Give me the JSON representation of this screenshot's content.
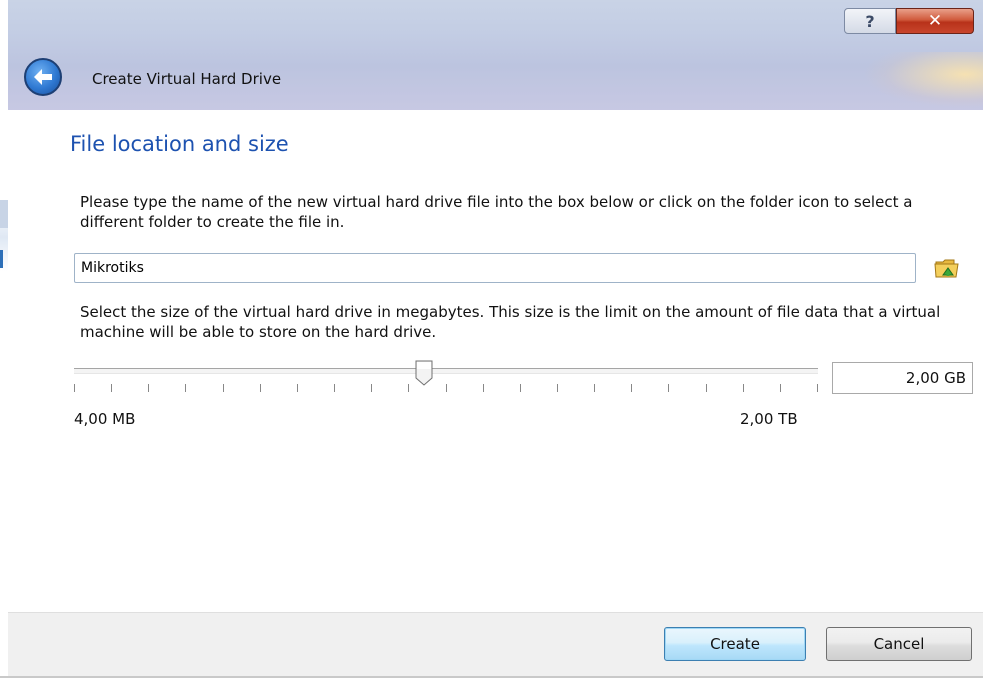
{
  "window": {
    "title": "Create Virtual Hard Drive",
    "help_glyph": "?",
    "close_glyph": "✕"
  },
  "page": {
    "heading": "File location and size",
    "location_description": "Please type the name of the new virtual hard drive file into the box below or click on the folder icon to select a different folder to create the file in.",
    "size_description": "Select the size of the virtual hard drive in megabytes. This size is the limit on the amount of file data that a virtual machine will be able to store on the hard drive."
  },
  "file_location": {
    "value": "Mikrotiks",
    "folder_icon": "folder-icon"
  },
  "size": {
    "value": "2,00 GB",
    "min_label": "4,00 MB",
    "max_label": "2,00 TB",
    "slider_fraction": 0.47
  },
  "buttons": {
    "create_label": "Create",
    "cancel_label": "Cancel"
  },
  "colors": {
    "heading": "#1d52b0",
    "close_button": "#c8452c",
    "default_button_border": "#3c7fb1"
  }
}
